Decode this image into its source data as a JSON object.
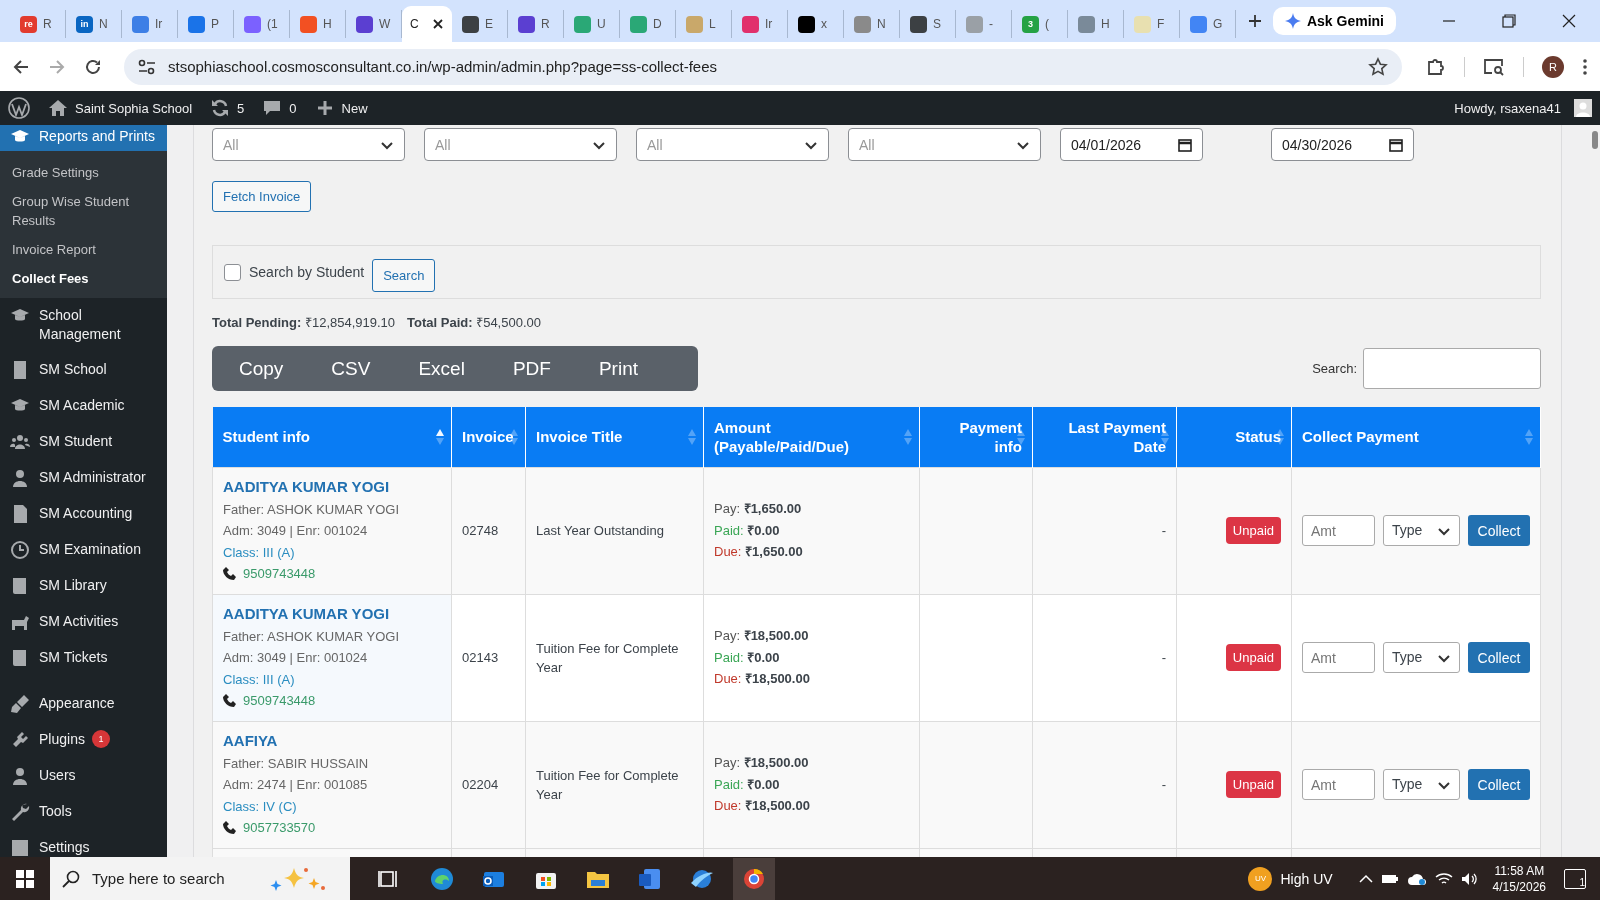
{
  "browser": {
    "tabs": [
      {
        "title": "R",
        "color": "#e23b2e",
        "icon_text": "re",
        "selected": false
      },
      {
        "title": "N",
        "color": "#0a66c2",
        "icon_text": "in",
        "selected": false
      },
      {
        "title": "Ir",
        "color": "#3d7fe6",
        "selected": false
      },
      {
        "title": "P",
        "color": "#1a73e8",
        "selected": false
      },
      {
        "title": "(1",
        "color": "#7b61ff",
        "selected": false
      },
      {
        "title": "H",
        "color": "#f25022",
        "selected": false
      },
      {
        "title": "W",
        "color": "#5b3fd1",
        "selected": false
      },
      {
        "title": "C",
        "selected": true
      },
      {
        "title": "E",
        "color": "#3c4043",
        "selected": false
      },
      {
        "title": "R",
        "color": "#5b3fd1",
        "selected": false
      },
      {
        "title": "U",
        "color": "#2aa876",
        "selected": false
      },
      {
        "title": "D",
        "color": "#2aa876",
        "selected": false
      },
      {
        "title": "L",
        "color": "#c9a86a",
        "selected": false
      },
      {
        "title": "Ir",
        "color": "#e1306c",
        "selected": false
      },
      {
        "title": "x",
        "color": "#000000",
        "selected": false
      },
      {
        "title": "N",
        "color": "#8a8a8a",
        "selected": false
      },
      {
        "title": "S",
        "color": "#3c4043",
        "selected": false
      },
      {
        "title": "-",
        "color": "#9aa0a6",
        "selected": false
      },
      {
        "title": "(",
        "color": "#25a244",
        "icon_text": "3",
        "selected": false
      },
      {
        "title": "H",
        "color": "#7a8a99",
        "selected": false
      },
      {
        "title": "F",
        "color": "#e8e0b0",
        "selected": false
      },
      {
        "title": "G",
        "color": "#4285f4",
        "selected": false
      }
    ],
    "gemini": "Ask Gemini",
    "url": "stsophiaschool.cosmosconsultant.co.in/wp-admin/admin.php?page=ss-collect-fees",
    "profile": "R"
  },
  "admin_bar": {
    "site": "Saint Sophia School",
    "updates": "5",
    "comments": "0",
    "new": "New",
    "howdy": "Howdy, rsaxena41"
  },
  "sidebar": {
    "items": [
      {
        "label": "Reports and Prints",
        "selected": true,
        "children": [
          {
            "label": "Grade Settings",
            "selected": false
          },
          {
            "label": "Group Wise Student Results",
            "selected": false
          },
          {
            "label": "Invoice Report",
            "selected": false
          },
          {
            "label": "Collect Fees",
            "selected": true
          }
        ]
      },
      {
        "label": "School Management",
        "selected": false
      },
      {
        "label": "SM School",
        "selected": false
      },
      {
        "label": "SM Academic",
        "selected": false
      },
      {
        "label": "SM Student",
        "selected": false
      },
      {
        "label": "SM Administrator",
        "selected": false
      },
      {
        "label": "SM Accounting",
        "selected": false
      },
      {
        "label": "SM Examination",
        "selected": false
      },
      {
        "label": "SM Library",
        "selected": false
      },
      {
        "label": "SM Activities",
        "selected": false
      },
      {
        "label": "SM Tickets",
        "selected": false
      },
      {
        "label": "Appearance",
        "selected": false,
        "separator_before": true
      },
      {
        "label": "Plugins",
        "selected": false,
        "badge": "1"
      },
      {
        "label": "Users",
        "selected": false
      },
      {
        "label": "Tools",
        "selected": false
      },
      {
        "label": "Settings",
        "selected": false
      }
    ]
  },
  "filters": {
    "selects": [
      {
        "value": "All"
      },
      {
        "value": "All"
      },
      {
        "value": "All"
      },
      {
        "value": "All"
      }
    ],
    "dates": [
      {
        "value": "04/01/2026"
      },
      {
        "value": "04/30/2026"
      }
    ],
    "fetch_button": "Fetch Invoice"
  },
  "student_search": {
    "checked": false,
    "label": "Search by Student",
    "button": "Search"
  },
  "totals": [
    "**Total Pending:** ₹12,854,919.10",
    "**Total Paid:** ₹54,500.00"
  ],
  "export_buttons": [
    "Copy",
    "CSV",
    "Excel",
    "PDF",
    "Print"
  ],
  "table_search": {
    "label": "Search:"
  },
  "table": {
    "columns": [
      {
        "label": "Student info",
        "sorted": true
      },
      {
        "label": "Invoice",
        "sorted": false
      },
      {
        "label": "Invoice Title",
        "sorted": false
      },
      {
        "label": "Amount (Payable/Paid/Due)",
        "sorted": false
      },
      {
        "label": "Payment info",
        "sorted": false
      },
      {
        "label": "Last Payment Date",
        "sorted": false
      },
      {
        "label": "Status",
        "sorted": false
      },
      {
        "label": "Collect Payment",
        "sorted": false
      }
    ],
    "rows": [
      {
        "name": "AADITYA KUMAR YOGI",
        "father": "Father: ASHOK KUMAR YOGI",
        "adm": "Adm: 3049 | Enr: 001024",
        "class": "Class: III (A)",
        "phone": "9509743448",
        "invoice": "02748",
        "title": "Last Year Outstanding",
        "amounts": [
          {
            "kind": "pay",
            "text": "Pay: **₹1,650.00**"
          },
          {
            "kind": "paid",
            "text": "Paid: **₹0.00**"
          },
          {
            "kind": "due",
            "text": "Due: **₹1,650.00**"
          }
        ],
        "last_payment": "-",
        "status": {
          "kind": "unpaid",
          "label": "Unpaid"
        },
        "amount_placeholder": "Amt",
        "type": "Type",
        "action": "Collect"
      },
      {
        "name": "AADITYA KUMAR YOGI",
        "father": "Father: ASHOK KUMAR YOGI",
        "adm": "Adm: 3049 | Enr: 001024",
        "class": "Class: III (A)",
        "phone": "9509743448",
        "invoice": "02143",
        "title": "Tuition Fee for Complete Year",
        "amounts": [
          {
            "kind": "pay",
            "text": "Pay: **₹18,500.00**"
          },
          {
            "kind": "paid",
            "text": "Paid: **₹0.00**"
          },
          {
            "kind": "due",
            "text": "Due: **₹18,500.00**"
          }
        ],
        "last_payment": "-",
        "status": {
          "kind": "unpaid",
          "label": "Unpaid"
        },
        "amount_placeholder": "Amt",
        "type": "Type",
        "action": "Collect"
      },
      {
        "name": "AAFIYA",
        "father": "Father: SABIR HUSSAIN",
        "adm": "Adm: 2474 | Enr: 001085",
        "class": "Class: IV (C)",
        "phone": "9057733570",
        "invoice": "02204",
        "title": "Tuition Fee for Complete Year",
        "amounts": [
          {
            "kind": "pay",
            "text": "Pay: **₹18,500.00**"
          },
          {
            "kind": "paid",
            "text": "Paid: **₹0.00**"
          },
          {
            "kind": "due",
            "text": "Due: **₹18,500.00**"
          }
        ],
        "last_payment": "-",
        "status": {
          "kind": "unpaid",
          "label": "Unpaid"
        },
        "amount_placeholder": "Amt",
        "type": "Type",
        "action": "Collect"
      }
    ]
  },
  "taskbar": {
    "search_placeholder": "Type here to search",
    "weather_badge": "UV",
    "weather": "High UV",
    "time": "11:58 AM",
    "date": "4/15/2026",
    "notifications": "1"
  }
}
